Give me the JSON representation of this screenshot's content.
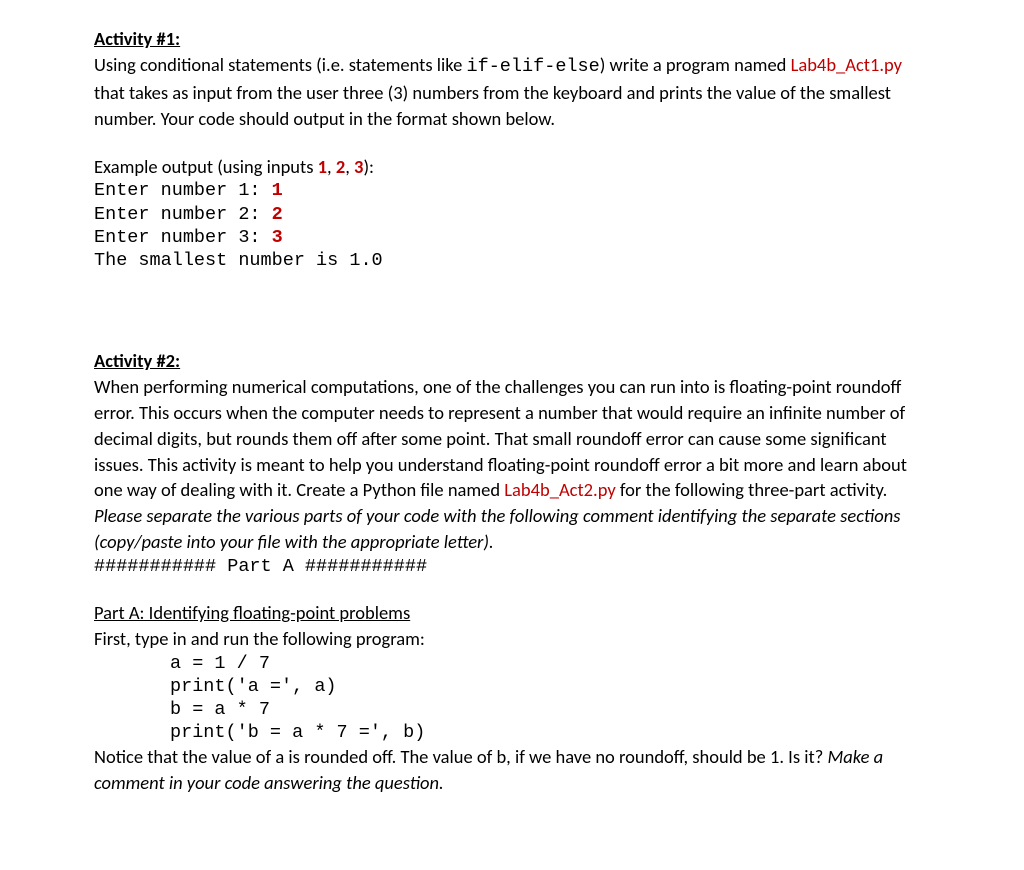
{
  "activity1": {
    "heading": "Activity #1:",
    "para_pre": "Using conditional statements (i.e. statements like ",
    "code_cond": "if-elif-else",
    "para_mid": ") write a program named ",
    "filename": "Lab4b_Act1.py",
    "para_post": " that takes as input from the user three (3) numbers from the keyboard and prints the value of the smallest number. Your code should output in the format shown below.",
    "example_label_pre": "Example output (using inputs ",
    "n1": "1",
    "c1": ", ",
    "n2": "2",
    "c2": ", ",
    "n3": "3",
    "example_label_post": "):",
    "line1_pre": "Enter number 1: ",
    "line1_val": "1",
    "line2_pre": "Enter number 2: ",
    "line2_val": "2",
    "line3_pre": "Enter number 3: ",
    "line3_val": "3",
    "line4": "The smallest number is 1.0"
  },
  "activity2": {
    "heading": "Activity #2:",
    "para_pre": "When performing numerical computations, one of the challenges you can run into is floating-point roundoff error. This occurs when the computer needs to represent a number that would require an infinite number of decimal digits, but rounds them off after some point. That small roundoff error can cause some significant issues. This activity is meant to help you understand floating-point roundoff error a bit more and learn about one way of dealing with it. Create a Python file named ",
    "filename": "Lab4b_Act2.py",
    "para_mid": " for the following three-part activity. ",
    "italic_part": "Please separate the various parts of your code with the following comment identifying the separate sections (copy/paste into your file with the appropriate letter).",
    "divider": "########### Part A ###########",
    "partA_heading": "Part A: Identifying floating-point problems",
    "partA_intro": "First, type in and run the following program:",
    "code_line1": "a = 1 / 7",
    "code_line2": "print('a =', a)",
    "code_line3": "b = a * 7",
    "code_line4": "print('b = a * 7 =', b)",
    "partA_notice": "Notice that the value of a is rounded off. The value of b, if we have no roundoff, should be 1. Is it? ",
    "partA_italic": "Make a comment in your code answering the question."
  }
}
